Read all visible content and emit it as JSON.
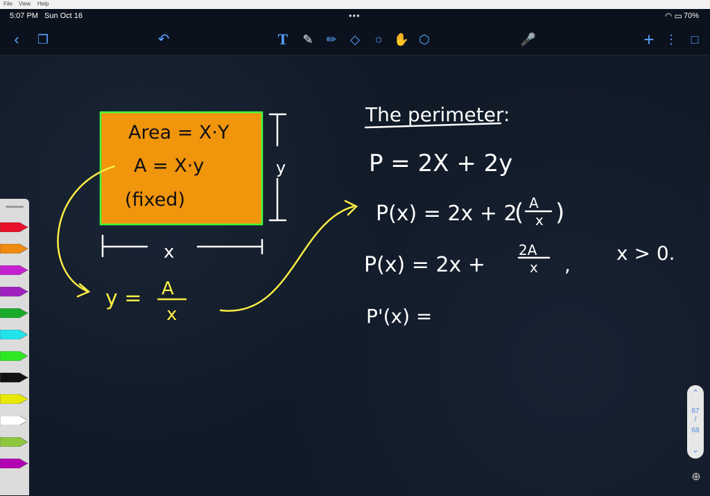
{
  "menubar": {
    "file": "File",
    "view": "View",
    "help": "Help"
  },
  "status": {
    "time": "5:07 PM",
    "date": "Sun Oct 16",
    "dots": "•••",
    "battery": "70%"
  },
  "toolbar": {
    "icons": [
      "back-icon",
      "pages-icon",
      "undo-icon",
      "text-tool-icon",
      "pen-tool-icon",
      "highlighter-icon",
      "eraser-icon",
      "lasso-icon",
      "hand-tool-icon",
      "shapes-icon",
      "microphone-icon",
      "add-icon",
      "more-icon",
      "page-view-icon"
    ]
  },
  "pager": {
    "current": "67",
    "separator": "/",
    "total": "68"
  },
  "board": {
    "rect_fill": "#f0950c",
    "rect_stroke": "#42ff3c",
    "ink_white": "#ffffff",
    "ink_yellow": "#ffee44",
    "area_label": "Area = X·Y",
    "formula_A": "A = X·y",
    "fixed_label": "(fixed)",
    "y_label": "y",
    "x_label": "x",
    "y_equals": "y =",
    "frac_A": "A",
    "frac_x": "x",
    "perimeter_heading": "The perimeter:",
    "eq1": "P = 2X + 2y",
    "eq2_left": "P(x) = 2x + 2",
    "eq2_num": "A",
    "eq2_den": "x",
    "eq3_left": "P(x) = 2x +",
    "eq3_num": "2A",
    "eq3_den": "x",
    "eq3_comma": ",",
    "condition": "x > 0.",
    "eq4": "P'(x) ="
  },
  "palette": {
    "colors": [
      "#e8102a",
      "#f08a10",
      "#c421d0",
      "#a121c0",
      "#1aaa2a",
      "#22e3ea",
      "#2ee824",
      "#111111",
      "#e8e800",
      "#ffffff",
      "#8ec63f",
      "#b300b3"
    ]
  }
}
